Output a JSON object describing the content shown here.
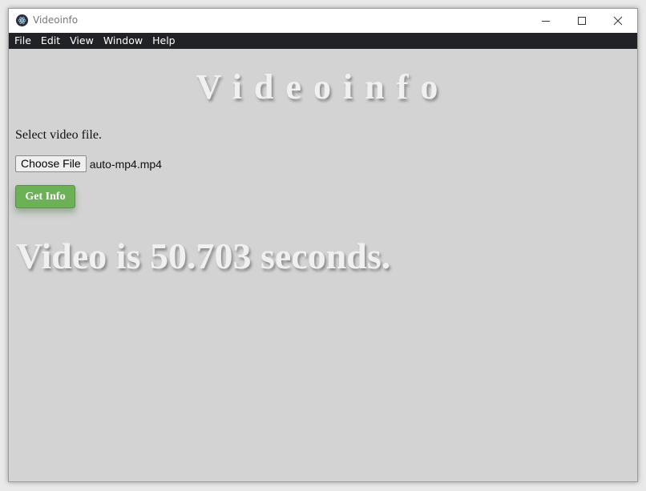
{
  "window": {
    "title": "Videoinfo",
    "icon": "electron-atom-icon"
  },
  "menu": {
    "items": [
      "File",
      "Edit",
      "View",
      "Window",
      "Help"
    ]
  },
  "main": {
    "heading": "Videoinfo",
    "prompt": "Select video file.",
    "file_button_label": "Choose File",
    "file_name": "auto-mp4.mp4",
    "get_info_label": "Get Info",
    "result": "Video is 50.703 seconds."
  },
  "colors": {
    "menubar": "#202225",
    "content_bg": "#d3d3d3",
    "button_green": "#6db157"
  }
}
